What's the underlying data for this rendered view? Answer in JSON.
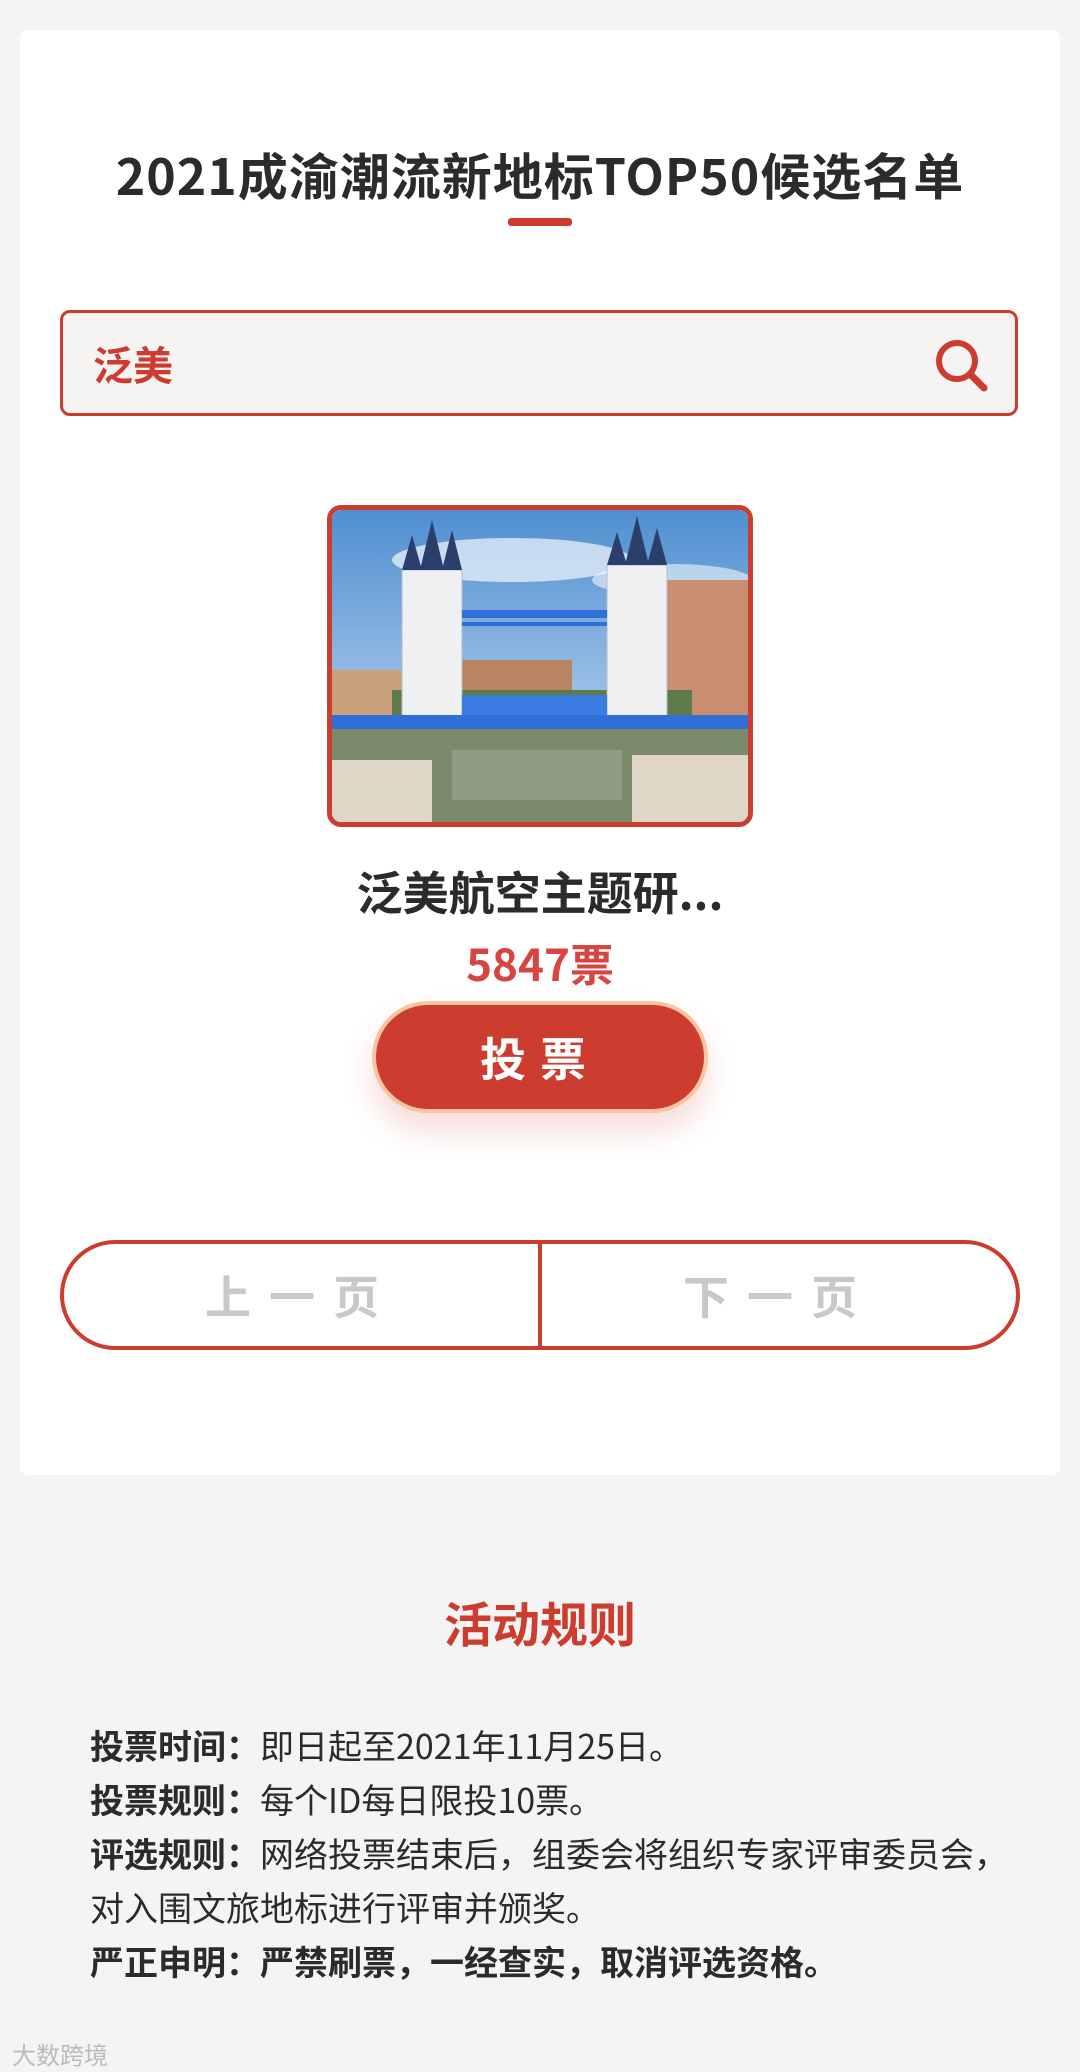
{
  "page_title": "2021成渝潮流新地标TOP50候选名单",
  "search": {
    "value": "泛美"
  },
  "item": {
    "name": "泛美航空主题研...",
    "votes": "5847票"
  },
  "buttons": {
    "vote": "投票",
    "prev": "上一页",
    "next": "下一页"
  },
  "rules": {
    "title": "活动规则",
    "time_label": "投票时间：",
    "time_text": "即日起至2021年11月25日。",
    "vote_label": "投票规则：",
    "vote_text": "每个ID每日限投10票。",
    "select_label": "评选规则：",
    "select_text": "网络投票结束后，组委会将组织专家评审委员会，对入围文旅地标进行评审并颁奖。",
    "notice_label": "严正申明：",
    "notice_text": "严禁刷票，一经查实，取消评选资格。"
  },
  "watermark": "大数跨境",
  "colors": {
    "accent": "#cc3d2f",
    "votes": "#d84540",
    "text": "#2b2b2b",
    "disabled": "#c8c8c8"
  }
}
